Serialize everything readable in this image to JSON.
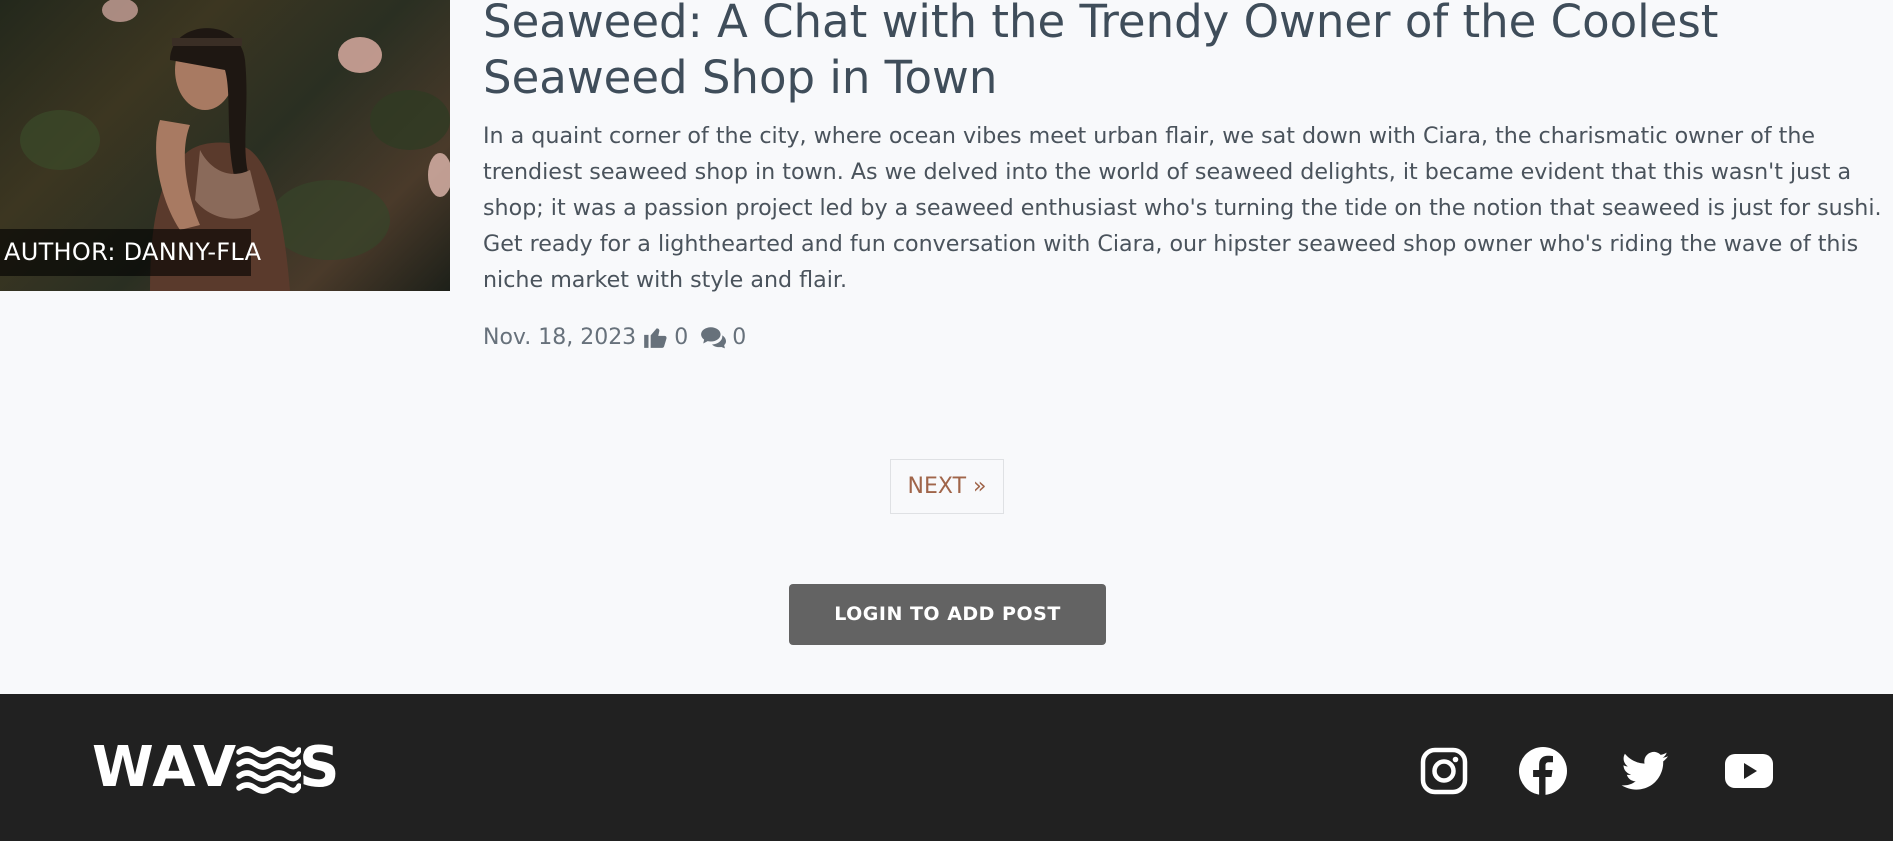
{
  "post": {
    "author_label": "AUTHOR: DANNY-FLA",
    "title": "Seaweed: A Chat with the Trendy Owner of the Coolest Seaweed Shop in Town",
    "excerpt": "In a quaint corner of the city, where ocean vibes meet urban flair, we sat down with Ciara, the charismatic owner of the trendiest seaweed shop in town. As we delved into the world of seaweed delights, it became evident that this wasn't just a shop; it was a passion project led by a seaweed enthusiast who's turning the tide on the notion that seaweed is just for sushi. Get ready for a lighthearted and fun conversation with Ciara, our hipster seaweed shop owner who's riding the wave of this niche market with style and flair.",
    "date": "Nov. 18, 2023",
    "likes": "0",
    "comments": "0",
    "like_icon": "thumbs-up-icon",
    "comment_icon": "comments-icon"
  },
  "pagination": {
    "next_label": "NEXT »"
  },
  "actions": {
    "login_label": "LOGIN TO ADD POST"
  },
  "footer": {
    "logo": {
      "before": "WAV",
      "after": "S",
      "mark_icon": "waves-icon"
    },
    "social": [
      "instagram-icon",
      "facebook-icon",
      "twitter-icon",
      "youtube-icon"
    ]
  },
  "colors": {
    "background": "#f8f9fb",
    "footer": "#212121",
    "button": "#636363",
    "link_accent": "#a0654a",
    "title": "#3f4d5a"
  }
}
